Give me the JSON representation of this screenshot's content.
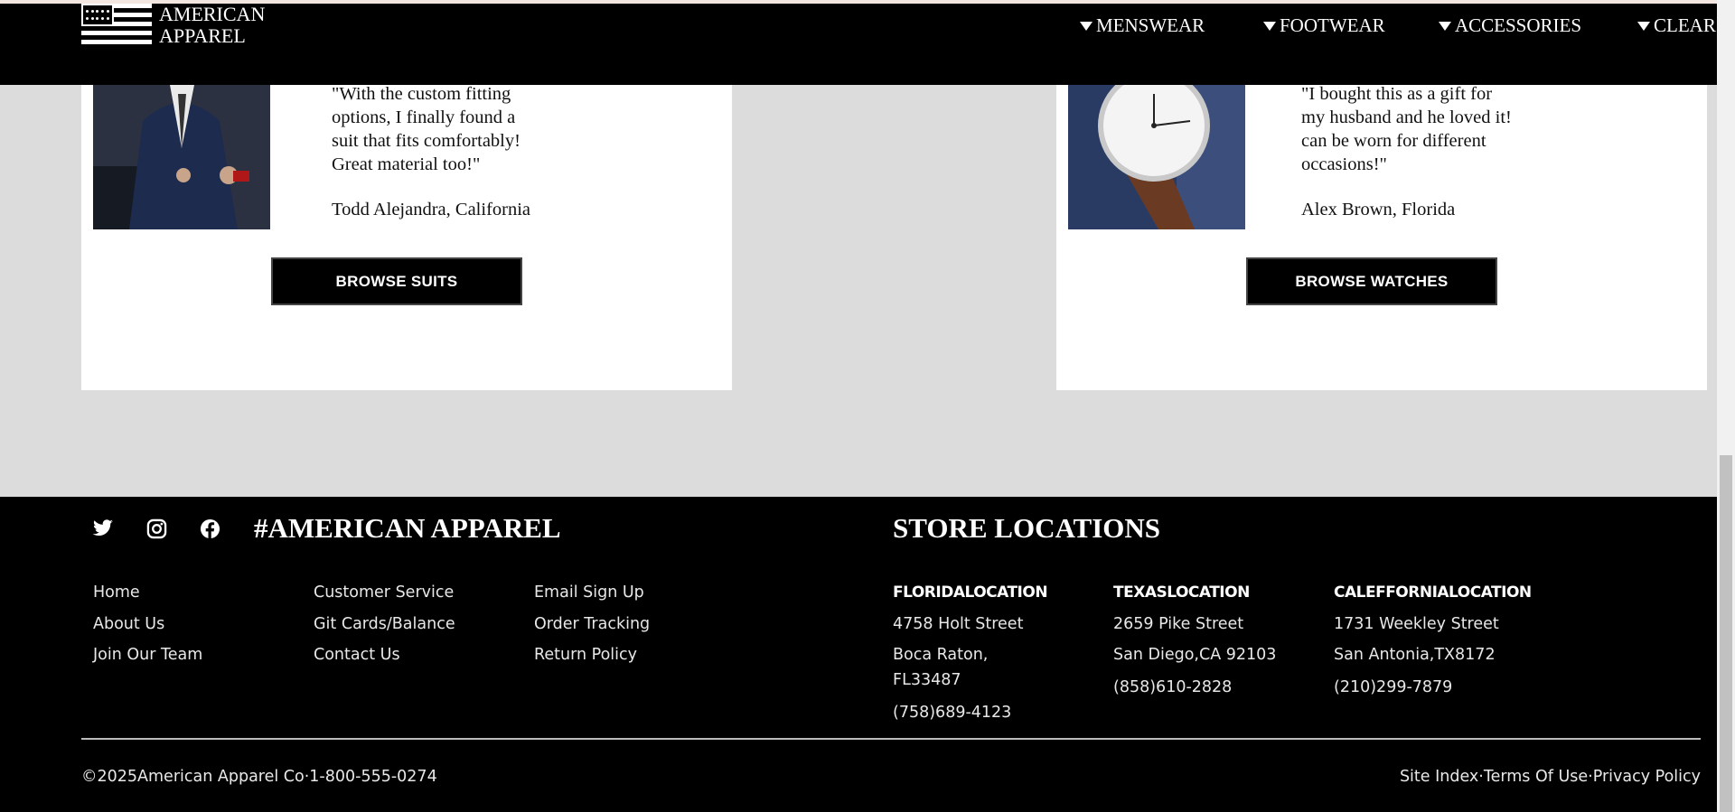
{
  "header": {
    "logo_line1": "AMERICAN",
    "logo_line2": "APPAREL",
    "nav": [
      {
        "label": "MENSWEAR"
      },
      {
        "label": "FOOTWEAR"
      },
      {
        "label": "ACCESSORIES"
      },
      {
        "label": "CLEAR"
      }
    ]
  },
  "testimonials": [
    {
      "photo_icon": "suit-photo",
      "quote_lines": [
        "\"With the custom fitting",
        "options, I finally found a",
        "suit that fits comfortably!",
        "Great material too!\""
      ],
      "author": "Todd Alejandra, California",
      "button": "BROWSE SUITS"
    },
    {
      "photo_icon": "watch-photo",
      "quote_lines": [
        "\"I bought this as a gift for",
        "my husband and he loved it!",
        "can be worn for different",
        "occasions!\""
      ],
      "author": "Alex Brown, Florida",
      "button": "BROWSE WATCHES"
    }
  ],
  "footer": {
    "social_icons": [
      "twitter-icon",
      "instagram-icon",
      "facebook-icon"
    ],
    "hashtag": "#AMERICAN APPAREL",
    "links_col1": [
      "Home",
      "About Us",
      "Join Our Team"
    ],
    "links_col2": [
      "Customer Service",
      "Git Cards/Balance",
      "Contact Us"
    ],
    "links_col3": [
      "Email Sign Up",
      "Order Tracking",
      "Return Policy"
    ],
    "locations_title": "STORE LOCATIONS",
    "locations": [
      {
        "name": "FLORIDALOCATION",
        "street": "4758 Holt Street",
        "city_line1": "Boca Raton,",
        "city_line2": "FL33487",
        "phone": "(758)689-4123"
      },
      {
        "name": "TEXASLOCATION",
        "street": "2659 Pike Street",
        "city_line1": "San Diego,CA 92103",
        "city_line2": "",
        "phone": "(858)610-2828"
      },
      {
        "name": "CALEFFORNIALOCATION",
        "street": "1731 Weekley Street",
        "city_line1": "San Antonia,TX8172",
        "city_line2": "",
        "phone": "(210)299-7879"
      }
    ],
    "copyright": "©2025American Apparel Co·1-800-555-0274",
    "legal": [
      "Site Index",
      "Terms Of Use",
      "Privacy Policy"
    ],
    "legal_sep": "·"
  }
}
